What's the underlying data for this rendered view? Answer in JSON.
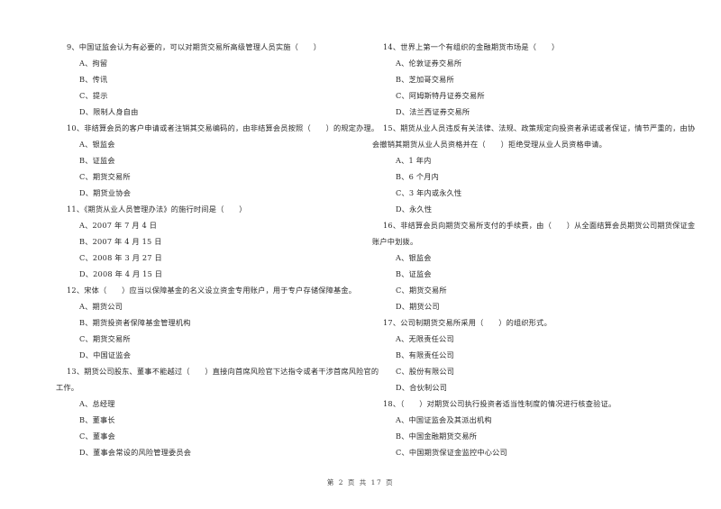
{
  "left_column": [
    {
      "lines": [
        "9、中国证监会认为有必要的，可以对期货交易所高级管理人员实施（　　）"
      ],
      "options": [
        "A、拘留",
        "B、传讯",
        "C、提示",
        "D、限制人身自由"
      ]
    },
    {
      "lines": [
        "10、非结算会员的客户申请或者注销其交易编码的，由非结算会员按照（　　）的规定办理。"
      ],
      "options": [
        "A、银监会",
        "B、证监会",
        "C、期货交易所",
        "D、期货业协会"
      ]
    },
    {
      "lines": [
        "11、《期货从业人员管理办法》的施行时间是（　　）"
      ],
      "options": [
        "A、2007 年 7 月 4 日",
        "B、2007 年 4 月 15 日",
        "C、2008 年 3 月 27 日",
        "D、2008 年 4 月 15 日"
      ]
    },
    {
      "lines": [
        "12、宋体（　　）应当以保障基金的名义设立资金专用账户，用于专户存储保障基金。"
      ],
      "options": [
        "A、期货公司",
        "B、期货投资者保障基金管理机构",
        "C、期货交易所",
        "D、中国证监会"
      ]
    },
    {
      "lines": [
        "13、期货公司股东、董事不能越过（　　）直接向首席风险官下达指令或者干涉首席风险官的",
        "工作。"
      ],
      "options": [
        "A、总经理",
        "B、董事长",
        "C、董事会",
        "D、董事会常设的风险管理委员会"
      ]
    }
  ],
  "right_column": [
    {
      "lines": [
        "14、世界上第一个有组织的金融期货市场是（　　）"
      ],
      "options": [
        "A、伦敦证券交易所",
        "B、芝加哥交易所",
        "C、阿姆斯特丹证券交易所",
        "D、法兰西证券交易所"
      ]
    },
    {
      "lines": [
        "15、期货从业人员违反有关法律、法规、政策规定向投资者承诺或者保证，情节严重的，由协",
        "会撤销其期货从业人员资格并在（　　）拒绝受理从业人员资格申请。"
      ],
      "options": [
        "A、1 年内",
        "B、6 个月内",
        "C、3 年内或永久性",
        "D、永久性"
      ]
    },
    {
      "lines": [
        "16、非结算会员向期货交易所支付的手续费，由（　　）从全面结算会员期货公司期货保证金",
        "账户中划拨。"
      ],
      "options": [
        "A、银监会",
        "B、证监会",
        "C、期货交易所",
        "D、期货公司"
      ]
    },
    {
      "lines": [
        "17、公司制期货交易所采用（　　）的组织形式。"
      ],
      "options": [
        "A、无限责任公司",
        "B、有限责任公司",
        "C、股份有限公司",
        "D、合伙制公司"
      ]
    },
    {
      "lines": [
        "18、（　　）对期货公司执行投资者适当性制度的情况进行核查验证。"
      ],
      "options": [
        "A、中国证监会及其派出机构",
        "B、中国金融期货交易所",
        "C、中国期货保证金监控中心公司"
      ]
    }
  ],
  "footer": {
    "page_label": "第 2 页 共 17 页"
  }
}
